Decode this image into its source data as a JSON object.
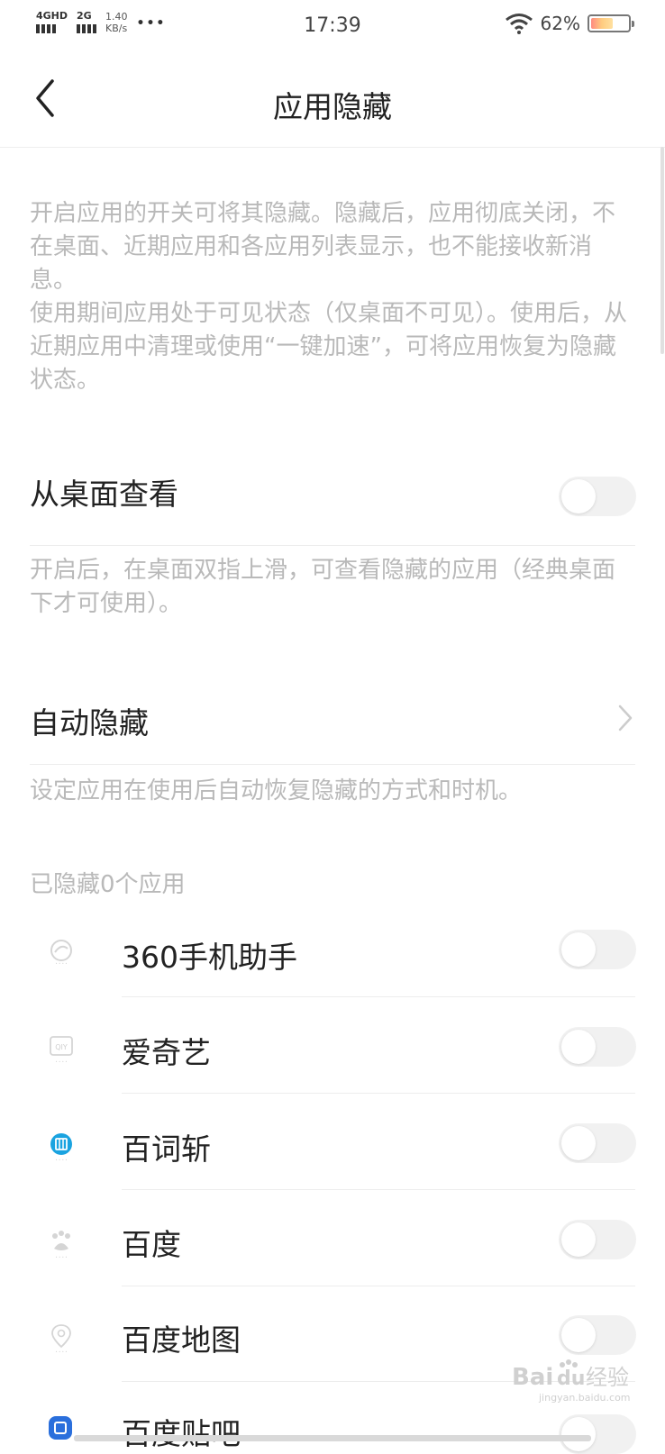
{
  "status_bar": {
    "sim1_label": "4GHD",
    "sim2_label": "2G",
    "speed_value": "1.40",
    "speed_unit": "KB/s",
    "more": "•••",
    "time": "17:39",
    "battery_percent": "62%",
    "battery_level": 0.62
  },
  "header": {
    "back_icon": "back-chevron-icon",
    "title": "应用隐藏"
  },
  "intro": {
    "paragraph1": "开启应用的开关可将其隐藏。隐藏后，应用彻底关闭，不在桌面、近期应用和各应用列表显示，也不能接收新消息。",
    "paragraph2": "使用期间应用处于可见状态（仅桌面不可见）。使用后，从近期应用中清理或使用“一键加速”，可将应用恢复为隐藏状态。"
  },
  "view_from_desktop": {
    "title": "从桌面查看",
    "enabled": false,
    "description": "开启后，在桌面双指上滑，可查看隐藏的应用（经典桌面下才可使用）。"
  },
  "auto_hide": {
    "title": "自动隐藏",
    "description": "设定应用在使用后自动恢复隐藏的方式和时机。"
  },
  "hidden_apps": {
    "count_label": "已隐藏0个应用",
    "apps": [
      {
        "name": "360手机助手",
        "icon": "360-assistant-icon",
        "enabled": false
      },
      {
        "name": "爱奇艺",
        "icon": "iqiyi-icon",
        "enabled": false
      },
      {
        "name": "百词斩",
        "icon": "baicizhan-icon",
        "enabled": false
      },
      {
        "name": "百度",
        "icon": "baidu-icon",
        "enabled": false
      },
      {
        "name": "百度地图",
        "icon": "baidu-map-icon",
        "enabled": false
      },
      {
        "name": "百度贴吧",
        "icon": "baidu-tieba-icon",
        "enabled": false
      }
    ]
  },
  "watermark": {
    "brand": "Bai",
    "brand2": "du",
    "suffix": "经验",
    "url": "jingyan.baidu.com"
  },
  "colors": {
    "toggle_off": "#f1f1f1",
    "secondary_text": "#b9b9b9",
    "divider": "#ededed",
    "baicizhan_blue": "#1aa3e0",
    "tieba_blue": "#2a6fdc"
  }
}
